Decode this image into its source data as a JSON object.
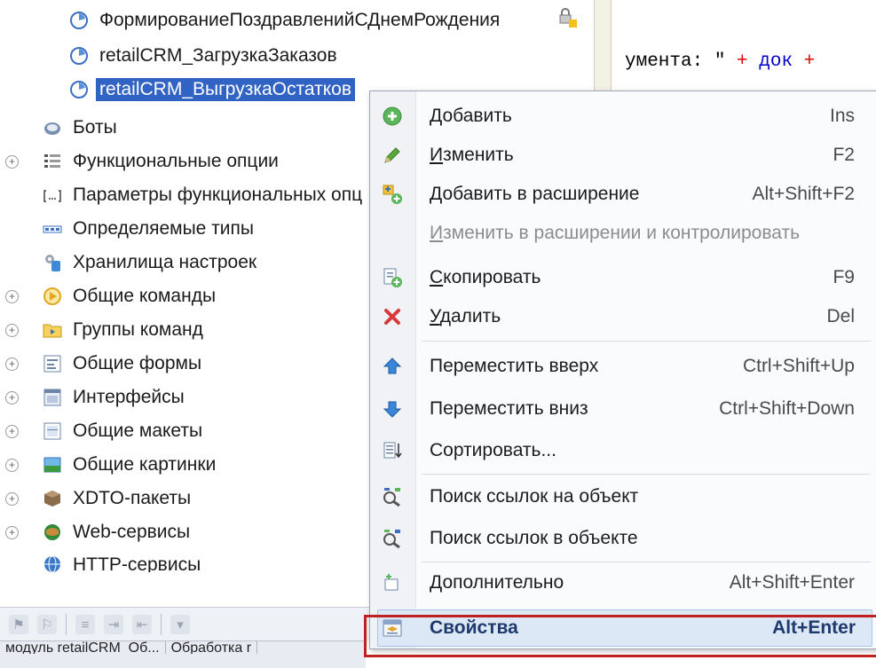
{
  "tree": {
    "items": [
      {
        "label": "ФормированиеПоздравленийСДнемРождения",
        "icon": "process-icon"
      },
      {
        "label": "retailCRM_ЗагрузкаЗаказов",
        "icon": "process-icon"
      },
      {
        "label": "retailCRM_ВыгрузкаОстатков",
        "icon": "process-icon",
        "selected": true
      },
      {
        "label": "Боты",
        "icon": "bot-icon"
      },
      {
        "label": "Функциональные опции",
        "icon": "functional-options-icon"
      },
      {
        "label": "Параметры функциональных опц",
        "icon": "functional-params-icon"
      },
      {
        "label": "Определяемые типы",
        "icon": "defined-types-icon"
      },
      {
        "label": "Хранилища настроек",
        "icon": "settings-storage-icon"
      },
      {
        "label": "Общие команды",
        "icon": "command-icon"
      },
      {
        "label": "Группы команд",
        "icon": "command-group-icon"
      },
      {
        "label": "Общие формы",
        "icon": "form-icon"
      },
      {
        "label": "Интерфейсы",
        "icon": "interface-icon"
      },
      {
        "label": "Общие макеты",
        "icon": "template-icon"
      },
      {
        "label": "Общие картинки",
        "icon": "picture-icon"
      },
      {
        "label": "XDTO-пакеты",
        "icon": "xdto-icon"
      },
      {
        "label": "Web-сервисы",
        "icon": "web-service-icon"
      },
      {
        "label": "HTTP-сервисы",
        "icon": "http-service-icon"
      }
    ]
  },
  "code_fragment": {
    "text_part": "умента: \"",
    "plus1": " + ",
    "keyword": "док",
    "plus2": " +"
  },
  "statusbar": {
    "tab1": "модуль retailCRM_Об...",
    "tab2": "Обработка r"
  },
  "context_menu": {
    "items": [
      {
        "label": "Добавить",
        "shortcut": "Ins",
        "icon": "add-icon"
      },
      {
        "label": "Изменить",
        "shortcut": "F2",
        "icon": "pencil-icon"
      },
      {
        "label": "Добавить в расширение",
        "shortcut": "Alt+Shift+F2",
        "icon": "add-to-extension-icon"
      },
      {
        "label": "Изменить в расширении и контролировать",
        "shortcut": "",
        "disabled": true
      },
      {
        "label": "Скопировать",
        "shortcut": "F9",
        "icon": "copy-icon"
      },
      {
        "label": "Удалить",
        "shortcut": "Del",
        "icon": "delete-icon"
      },
      {
        "label": "Переместить вверх",
        "shortcut": "Ctrl+Shift+Up",
        "icon": "arrow-up-icon"
      },
      {
        "label": "Переместить вниз",
        "shortcut": "Ctrl+Shift+Down",
        "icon": "arrow-down-icon"
      },
      {
        "label": "Сортировать...",
        "shortcut": "",
        "icon": "sort-icon"
      },
      {
        "label": "Поиск ссылок на объект",
        "shortcut": "",
        "icon": "find-refs-to-icon"
      },
      {
        "label": "Поиск ссылок в объекте",
        "shortcut": "",
        "icon": "find-refs-in-icon"
      },
      {
        "label": "Дополнительно",
        "shortcut": "Alt+Shift+Enter",
        "icon": "more-icon"
      },
      {
        "label": "Свойства",
        "shortcut": "Alt+Enter",
        "icon": "properties-icon",
        "highlighted": true
      }
    ]
  },
  "colors": {
    "selection": "#3163c5",
    "highlight_box": "#c02020",
    "menu_hover": "#dde8f7"
  }
}
